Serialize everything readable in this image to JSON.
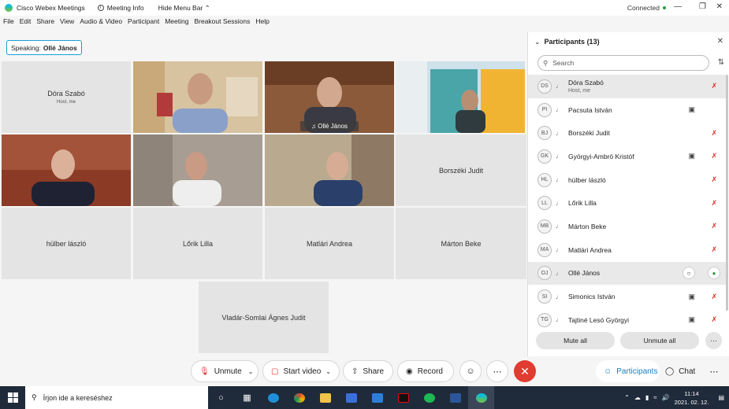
{
  "titlebar": {
    "app_title": "Cisco Webex Meetings",
    "meeting_info": "Meeting Info",
    "hide_menu_bar": "Hide Menu Bar",
    "connected": "Connected"
  },
  "menu": [
    "File",
    "Edit",
    "Share",
    "View",
    "Audio & Video",
    "Participant",
    "Meeting",
    "Breakout Sessions",
    "Help"
  ],
  "speaking": {
    "label": "Speaking:",
    "name": "Ollé János"
  },
  "tiles": [
    {
      "name": "Dóra Szabó",
      "sub": "Host, me"
    },
    {
      "name": "Borszéki Judit"
    },
    {
      "name": "hülber lászló"
    },
    {
      "name": "Lőrik Lilla"
    },
    {
      "name": "Matlári Andrea"
    },
    {
      "name": "Márton Beke"
    },
    {
      "name": "Vladár-Somlai Ágnes Judit"
    }
  ],
  "video_chip": "Ollé János",
  "controls": {
    "unmute": "Unmute",
    "start_video": "Start video",
    "share": "Share",
    "record": "Record",
    "participants": "Participants",
    "chat": "Chat"
  },
  "panel": {
    "title": "Participants (13)",
    "search_placeholder": "Search",
    "mute_all": "Mute all",
    "unmute_all": "Unmute all"
  },
  "participants": [
    {
      "initials": "DS",
      "name": "Dóra Szabó",
      "sub": "Host, me",
      "camera": false,
      "muted": true,
      "selected": true
    },
    {
      "initials": "PI",
      "name": "Pacsuta István",
      "camera": true,
      "muted": false
    },
    {
      "initials": "BJ",
      "name": "Borszéki Judit",
      "camera": false,
      "muted": true
    },
    {
      "initials": "GK",
      "name": "Györgyi-Ambró Kristóf",
      "camera": true,
      "muted": true
    },
    {
      "initials": "HL",
      "name": "hülber lászló",
      "camera": false,
      "muted": true
    },
    {
      "initials": "LL",
      "name": "Lőrik Lilla",
      "camera": false,
      "muted": true
    },
    {
      "initials": "MB",
      "name": "Márton Beke",
      "camera": false,
      "muted": true
    },
    {
      "initials": "MA",
      "name": "Matlári Andrea",
      "camera": false,
      "muted": true
    },
    {
      "initials": "OJ",
      "name": "Ollé János",
      "camera": false,
      "muted": false,
      "selected": true
    },
    {
      "initials": "SI",
      "name": "Simonics István",
      "camera": true,
      "muted": true
    },
    {
      "initials": "TG",
      "name": "Tajtiné Lesó Györgyi",
      "camera": true,
      "muted": true
    }
  ],
  "taskbar": {
    "search_placeholder": "Írjon ide a kereséshez",
    "time": "11:14",
    "date": "2021. 02. 12."
  },
  "colors": {
    "accent": "#1aa0d5",
    "end_call": "#e03c31",
    "muted": "#d93025",
    "taskbar": "#1f2a3a"
  }
}
